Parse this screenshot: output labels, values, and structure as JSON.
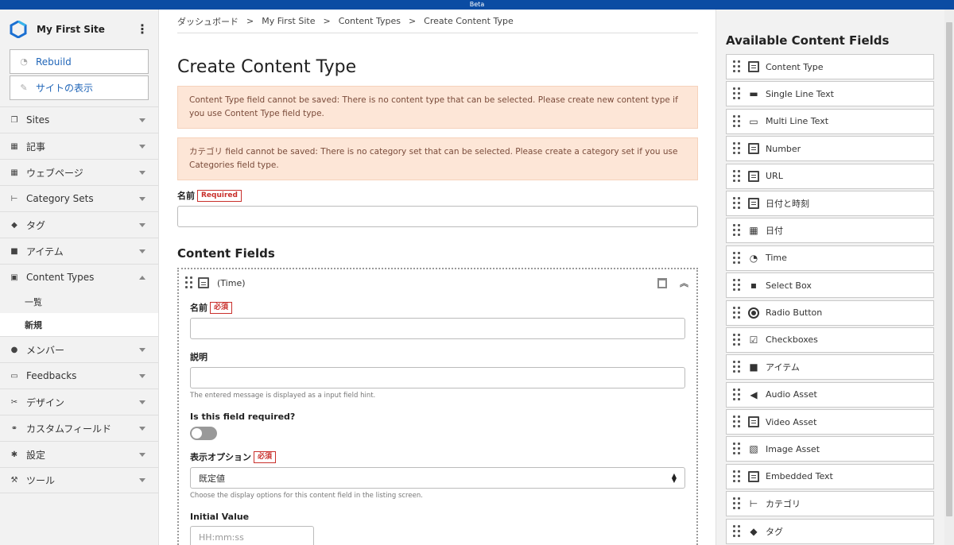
{
  "beta_label": "Beta",
  "site": {
    "name": "My First Site"
  },
  "sidebar": {
    "buttons": [
      {
        "label": "Rebuild"
      },
      {
        "label": "サイトの表示"
      }
    ],
    "items": [
      {
        "label": "Sites"
      },
      {
        "label": "記事"
      },
      {
        "label": "ウェブページ"
      },
      {
        "label": "Category Sets"
      },
      {
        "label": "タグ"
      },
      {
        "label": "アイテム"
      },
      {
        "label": "Content Types"
      },
      {
        "label": "メンバー"
      },
      {
        "label": "Feedbacks"
      },
      {
        "label": "デザイン"
      },
      {
        "label": "カスタムフィールド"
      },
      {
        "label": "設定"
      },
      {
        "label": "ツール"
      }
    ],
    "content_types_sub": [
      {
        "label": "一覧"
      },
      {
        "label": "新規"
      }
    ]
  },
  "breadcrumb": [
    "ダッシュボード",
    "My First Site",
    "Content Types",
    "Create Content Type"
  ],
  "breadcrumb_sep": ">",
  "page_title": "Create Content Type",
  "alerts": [
    "Content Type field cannot be saved: There is no content type that can be selected. Please create new content type if you use Content Type field type.",
    "カテゴリ field cannot be saved: There is no category set that can be selected. Please create a category set if you use Categories field type."
  ],
  "name_field": {
    "label": "名前",
    "required": "Required"
  },
  "content_fields_title": "Content Fields",
  "content_field": {
    "type_label": "(Time)",
    "name_label": "名前",
    "name_required": "必須",
    "desc_label": "説明",
    "desc_hint": "The entered message is displayed as a input field hint.",
    "required_q": "Is this field required?",
    "display_label": "表示オプション",
    "display_required": "必須",
    "display_value": "既定値",
    "display_hint": "Choose the display options for this content field in the listing screen.",
    "initial_label": "Initial Value",
    "initial_placeholder": "HH:mm:ss"
  },
  "available": {
    "title": "Available Content Fields",
    "fields": [
      {
        "label": "Content Type",
        "icon": "content-type-icon"
      },
      {
        "label": "Single Line Text",
        "icon": "single-line-text-icon"
      },
      {
        "label": "Multi Line Text",
        "icon": "multi-line-text-icon"
      },
      {
        "label": "Number",
        "icon": "number-icon"
      },
      {
        "label": "URL",
        "icon": "url-icon"
      },
      {
        "label": "日付と時刻",
        "icon": "datetime-icon"
      },
      {
        "label": "日付",
        "icon": "calendar-icon"
      },
      {
        "label": "Time",
        "icon": "clock-icon"
      },
      {
        "label": "Select Box",
        "icon": "select-box-icon"
      },
      {
        "label": "Radio Button",
        "icon": "radio-icon"
      },
      {
        "label": "Checkboxes",
        "icon": "checkbox-icon"
      },
      {
        "label": "アイテム",
        "icon": "briefcase-icon"
      },
      {
        "label": "Audio Asset",
        "icon": "audio-icon"
      },
      {
        "label": "Video Asset",
        "icon": "video-icon"
      },
      {
        "label": "Image Asset",
        "icon": "image-icon"
      },
      {
        "label": "Embedded Text",
        "icon": "embedded-text-icon"
      },
      {
        "label": "カテゴリ",
        "icon": "category-icon"
      },
      {
        "label": "タグ",
        "icon": "tag-icon"
      }
    ]
  },
  "colors": {
    "brand": "#0b4ca3",
    "link": "#2166b8",
    "alert_bg": "#fde6d7",
    "required": "#c9302c"
  }
}
